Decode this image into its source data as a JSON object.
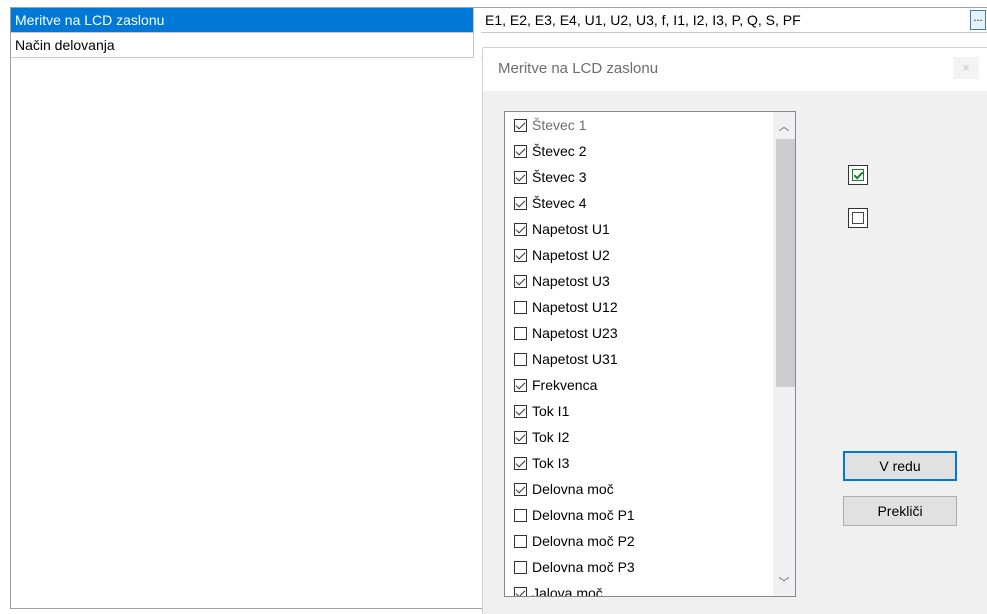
{
  "property_grid": {
    "rows": [
      {
        "name": "Meritve na LCD zaslonu",
        "value": "E1, E2, E3, E4, U1, U2, U3, f, I1, I2, I3, P, Q, S, PF",
        "selected": true,
        "button": "..."
      },
      {
        "name": "Način delovanja",
        "value": ""
      }
    ]
  },
  "dialog": {
    "title": "Meritve na LCD zaslonu",
    "close_label": "×",
    "items": [
      {
        "label": "Števec 1",
        "checked": true,
        "dim": true
      },
      {
        "label": "Števec 2",
        "checked": true
      },
      {
        "label": "Števec 3",
        "checked": true
      },
      {
        "label": "Števec 4",
        "checked": true
      },
      {
        "label": "Napetost U1",
        "checked": true
      },
      {
        "label": "Napetost U2",
        "checked": true
      },
      {
        "label": "Napetost U3",
        "checked": true
      },
      {
        "label": "Napetost U12",
        "checked": false
      },
      {
        "label": "Napetost U23",
        "checked": false
      },
      {
        "label": "Napetost U31",
        "checked": false
      },
      {
        "label": "Frekvenca",
        "checked": true
      },
      {
        "label": "Tok I1",
        "checked": true
      },
      {
        "label": "Tok I2",
        "checked": true
      },
      {
        "label": "Tok I3",
        "checked": true
      },
      {
        "label": "Delovna moč",
        "checked": true
      },
      {
        "label": "Delovna moč P1",
        "checked": false
      },
      {
        "label": "Delovna moč P2",
        "checked": false
      },
      {
        "label": "Delovna moč P3",
        "checked": false
      },
      {
        "label": "Jalova moč",
        "checked": true
      }
    ],
    "scroll_up": "︿",
    "scroll_down": "﹀",
    "ok_label": "V redu",
    "cancel_label": "Prekliči"
  }
}
